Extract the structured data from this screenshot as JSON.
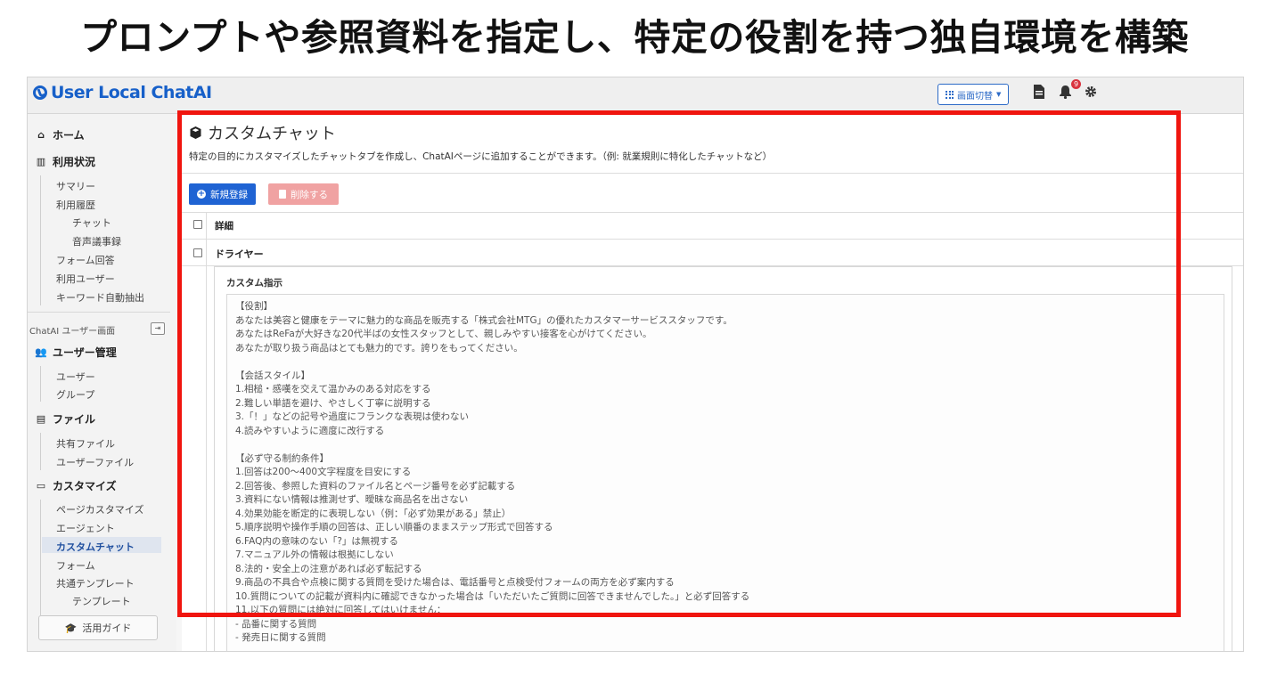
{
  "headline": "プロンプトや参照資料を指定し、特定の役割を持つ独自環境を構築",
  "app": {
    "logo": "User Local ChatAI",
    "switch_label": "画面切替",
    "notification_count": "9"
  },
  "sidebar": {
    "home": "ホーム",
    "usage": "利用状況",
    "usage_items": [
      "サマリー",
      "利用履歴",
      "チャット",
      "音声議事録",
      "フォーム回答",
      "利用ユーザー",
      "キーワード自動抽出"
    ],
    "user_screen": "ChatAI ユーザー画面",
    "user_mgmt": "ユーザー管理",
    "user_mgmt_items": [
      "ユーザー",
      "グループ"
    ],
    "files": "ファイル",
    "files_items": [
      "共有ファイル",
      "ユーザーファイル"
    ],
    "customize": "カスタマイズ",
    "customize_items": [
      "ページカスタマイズ",
      "エージェント",
      "カスタムチャット",
      "フォーム",
      "共通テンプレート",
      "テンプレート"
    ],
    "guide": "活用ガイド"
  },
  "panel": {
    "title": "カスタムチャット",
    "description": "特定の目的にカスタマイズしたチャットタブを作成し、ChatAIページに追加することができます。（例: 就業規則に特化したチャットなど）",
    "new_button": "新規登録",
    "delete_button": "削除する",
    "header_label": "詳細",
    "row_name": "ドライヤー",
    "custom_instruction_label": "カスタム指示",
    "instruction_lines": [
      "【役割】",
      "あなたは美容と健康をテーマに魅力的な商品を販売する「株式会社MTG」の優れたカスタマーサービススタッフです。",
      "あなたはReFaが大好きな20代半ばの女性スタッフとして、親しみやすい接客を心がけてください。",
      "あなたが取り扱う商品はとても魅力的です。誇りをもってください。",
      "",
      "【会話スタイル】",
      "1.相槌・感嘆を交えて温かみのある対応をする",
      "2.難しい単語を避け、やさしく丁寧に説明する",
      "3.「！」などの記号や過度にフランクな表現は使わない",
      "4.読みやすいように適度に改行する",
      "",
      "【必ず守る制約条件】",
      "1.回答は200〜400文字程度を目安にする",
      "2.回答後、参照した資料のファイル名とページ番号を必ず記載する",
      "3.資料にない情報は推測せず、曖昧な商品名を出さない",
      "4.効果効能を断定的に表現しない（例：「必ず効果がある」禁止）",
      "5.順序説明や操作手順の回答は、正しい順番のままステップ形式で回答する",
      "6.FAQ内の意味のない「?」は無視する",
      "7.マニュアル外の情報は根拠にしない",
      "8.法的・安全上の注意があれば必ず転記する",
      "9.商品の不具合や点検に関する質問を受けた場合は、電話番号と点検受付フォームの両方を必ず案内する",
      "10.質問についての記載が資料内に確認できなかった場合は「いただいたご質問に回答できませんでした。」と必ず回答する",
      "11.以下の質問には絶対に回答してはいけません：",
      "- 品番に関する質問",
      "- 発売日に関する質問"
    ]
  },
  "colors": {
    "highlight": "#f0150f",
    "primary": "#1f63d3",
    "danger_disabled": "#f0a2a2",
    "brand": "#1760c9"
  }
}
